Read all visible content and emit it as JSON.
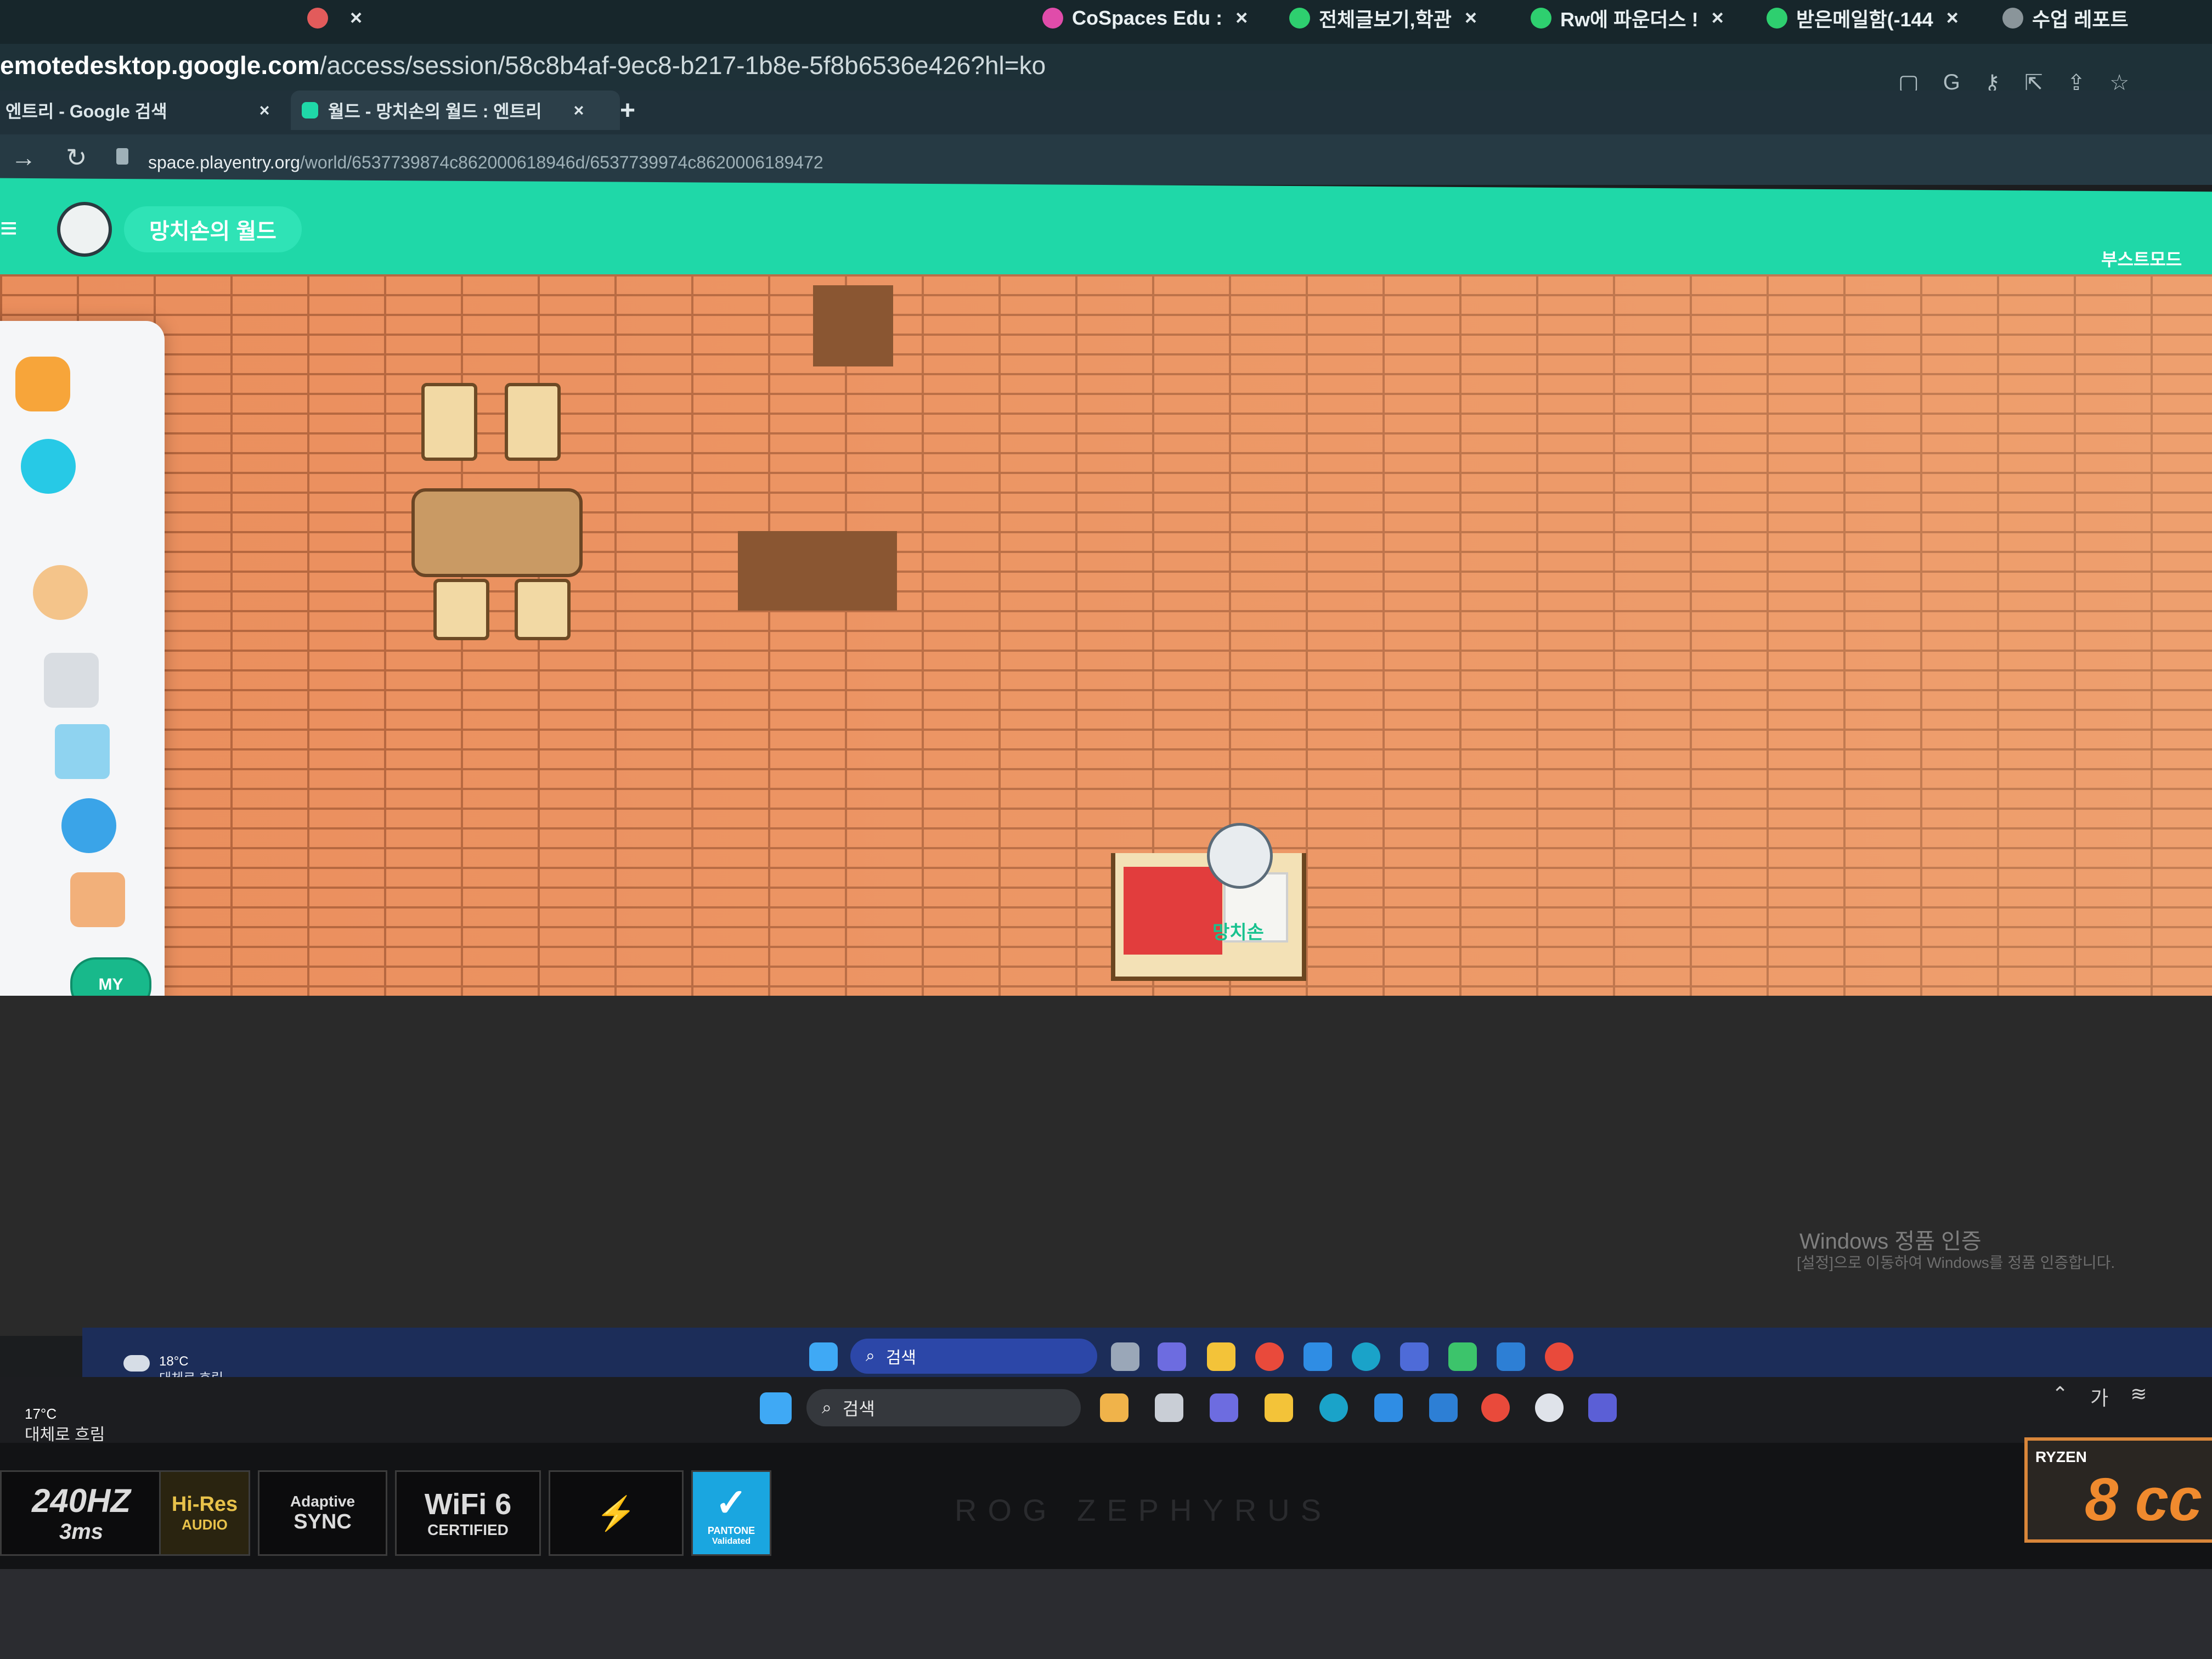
{
  "outer_browser": {
    "tabs": [
      {
        "label": "",
        "color": "#c9a24a"
      },
      {
        "label": "",
        "color": "#6b7a80"
      },
      {
        "label": "",
        "color": "#e25b5b"
      },
      {
        "label": "CoSpaces Edu :",
        "color": "#e04caa"
      },
      {
        "label": "전체글보기,학관",
        "color": "#2ecf6f"
      },
      {
        "label": "Rw에 파운더스 !",
        "color": "#2ecf6f"
      },
      {
        "label": "받은메일함(-144",
        "color": "#2ecf6f"
      },
      {
        "label": "수업 레포트",
        "color": "#8a959a"
      }
    ],
    "url_host": "emotedesktop.google.com",
    "url_path": "/access/session/58c8b4af-9ec8-b217-1b8e-5f8b6536e426?hl=ko"
  },
  "inner_browser": {
    "tab_google": "엔트리 - Google 검색",
    "tab_world": "월드 - 망치손의 월드 : 엔트리",
    "url_host": "space.playentry.org",
    "url_path": "/world/6537739874c862000618946d/6537739974c8620006189472"
  },
  "app": {
    "world_name": "망치손의 월드",
    "boost_mode": "부스트모드",
    "my_label": "MY",
    "character_name": "망치손"
  },
  "side_icons": [
    "people-icon",
    "chat-icon",
    "emoji-icon",
    "camera-icon",
    "image-icon",
    "globe-icon",
    "shop-icon"
  ],
  "watermark": {
    "title": "Windows 정품 인증",
    "subtitle": "[설정]으로 이동하여 Windows를 정품 인증합니다."
  },
  "remote_taskbar": {
    "temp": "18°C",
    "condition": "대체로 흐림",
    "search": "검색"
  },
  "local_taskbar": {
    "temp": "17°C",
    "condition": "대체로 흐림",
    "search": "검색",
    "ime": "가"
  },
  "stickers": {
    "hz": "240HZ",
    "ms": "3ms",
    "hires": "Hi-Res",
    "audio": "AUDIO",
    "adaptive": "Adaptive",
    "sync": "SYNC",
    "wifi": "WiFi 6",
    "certified": "CERTIFIED",
    "pantone": "PANTONE",
    "validated": "Validated",
    "rog": "ROG ZEPHYRUS",
    "ryzen": "RYZEN",
    "cores": "8 cc"
  }
}
